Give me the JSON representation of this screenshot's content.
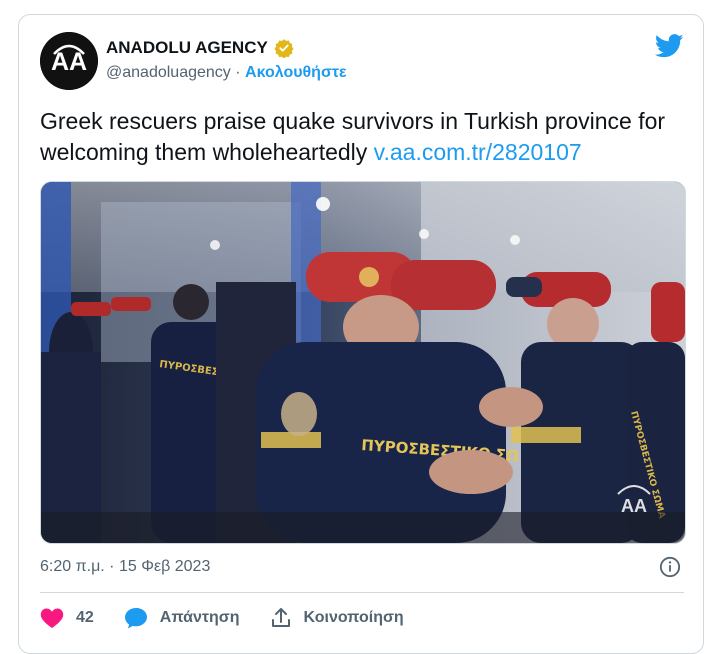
{
  "tweet": {
    "author_name": "ANADOLU AGENCY",
    "handle": "@anadoluagency",
    "separator": "·",
    "follow_label": "Ακολουθήστε",
    "text": "Greek rescuers praise quake survivors in Turkish province for welcoming them wholeheartedly",
    "link": "v.aa.com.tr/2820107",
    "timestamp": "6:20 π.μ. · 15 Φεβ 2023",
    "likes": "42",
    "reply_label": "Απάντηση",
    "share_label": "Κοινοποίηση",
    "avatar_logo": "AA",
    "media_watermark": "AA",
    "uniform_text_left": "ΠΥΡΟΣΒΕΣΤΙΚΟ ΣΩΜΑ",
    "uniform_text_center": "ΠΥΡΟΣΒΕΣΤΙΚΟ ΣΩ",
    "uniform_text_right": "ΠΥΡΟΣΒΕΣΤΙΚΟ ΣΩΜΑ"
  },
  "icons": {
    "verified": "verified-badge-icon",
    "brand": "twitter-bird-icon",
    "info": "info-icon",
    "like": "heart-icon",
    "reply": "reply-bubble-icon",
    "share": "share-icon"
  },
  "colors": {
    "accent": "#1d9bf0",
    "like": "#f91880",
    "verified_gold": "#e2b719",
    "text_secondary": "#536471",
    "border": "#cfd9de"
  }
}
